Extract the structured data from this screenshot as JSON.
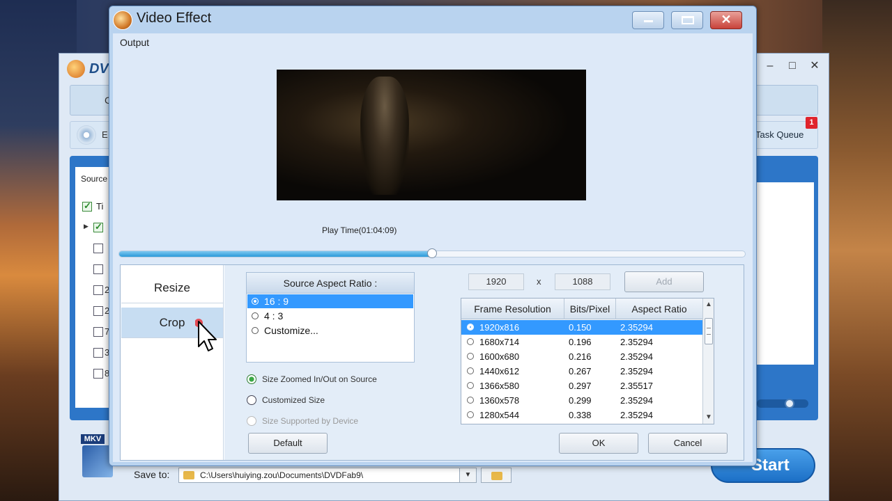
{
  "main_window": {
    "title": "DV",
    "toolbar_partial": "C",
    "row2_partial": "E",
    "task_queue_label": "Task Queue",
    "task_queue_badge": "1",
    "source_label": "Source",
    "tree_header": "Ti",
    "tree_rows": [
      {
        "digit": "",
        "checked": true
      },
      {
        "digit": "",
        "checked": false
      },
      {
        "digit": "",
        "checked": false
      },
      {
        "digit": "2",
        "checked": false
      },
      {
        "digit": "2",
        "checked": false
      },
      {
        "digit": "7",
        "checked": false
      },
      {
        "digit": "3",
        "checked": false
      },
      {
        "digit": "8",
        "checked": false
      }
    ],
    "format_badge": "MKV",
    "save_to_label": "Save to:",
    "save_path": "C:\\Users\\huiying.zou\\Documents\\DVDFab9\\",
    "start_label": "Start",
    "window_buttons": {
      "minimize": "–",
      "maximize": "□",
      "close": "✕"
    }
  },
  "dialog": {
    "title": "Video Effect",
    "output_label": "Output",
    "play_time": "Play Time(01:04:09)",
    "seek_progress": 0.5,
    "side_tabs": [
      {
        "label": "Resize",
        "selected": false
      },
      {
        "label": "Crop",
        "selected": true
      }
    ],
    "aspect": {
      "header": "Source Aspect Ratio :",
      "items": [
        {
          "label": "16 : 9",
          "selected": true
        },
        {
          "label": "4 : 3",
          "selected": false
        },
        {
          "label": "Customize...",
          "selected": false
        }
      ]
    },
    "size_options": [
      {
        "label": "Size Zoomed In/Out on Source",
        "state": "on"
      },
      {
        "label": "Customized Size",
        "state": "off"
      },
      {
        "label": "Size Supported by Device",
        "state": "disabled"
      }
    ],
    "width_value": "1920",
    "height_value": "1088",
    "x_sep": "x",
    "add_label": "Add",
    "grid": {
      "headers": [
        "Frame Resolution",
        "Bits/Pixel",
        "Aspect Ratio"
      ],
      "rows": [
        {
          "res": "1920x816",
          "bpp": "0.150",
          "ar": "2.35294",
          "selected": true
        },
        {
          "res": "1680x714",
          "bpp": "0.196",
          "ar": "2.35294",
          "selected": false
        },
        {
          "res": "1600x680",
          "bpp": "0.216",
          "ar": "2.35294",
          "selected": false
        },
        {
          "res": "1440x612",
          "bpp": "0.267",
          "ar": "2.35294",
          "selected": false
        },
        {
          "res": "1366x580",
          "bpp": "0.297",
          "ar": "2.35517",
          "selected": false
        },
        {
          "res": "1360x578",
          "bpp": "0.299",
          "ar": "2.35294",
          "selected": false
        },
        {
          "res": "1280x544",
          "bpp": "0.338",
          "ar": "2.35294",
          "selected": false
        }
      ]
    },
    "default_label": "Default",
    "ok_label": "OK",
    "cancel_label": "Cancel"
  }
}
